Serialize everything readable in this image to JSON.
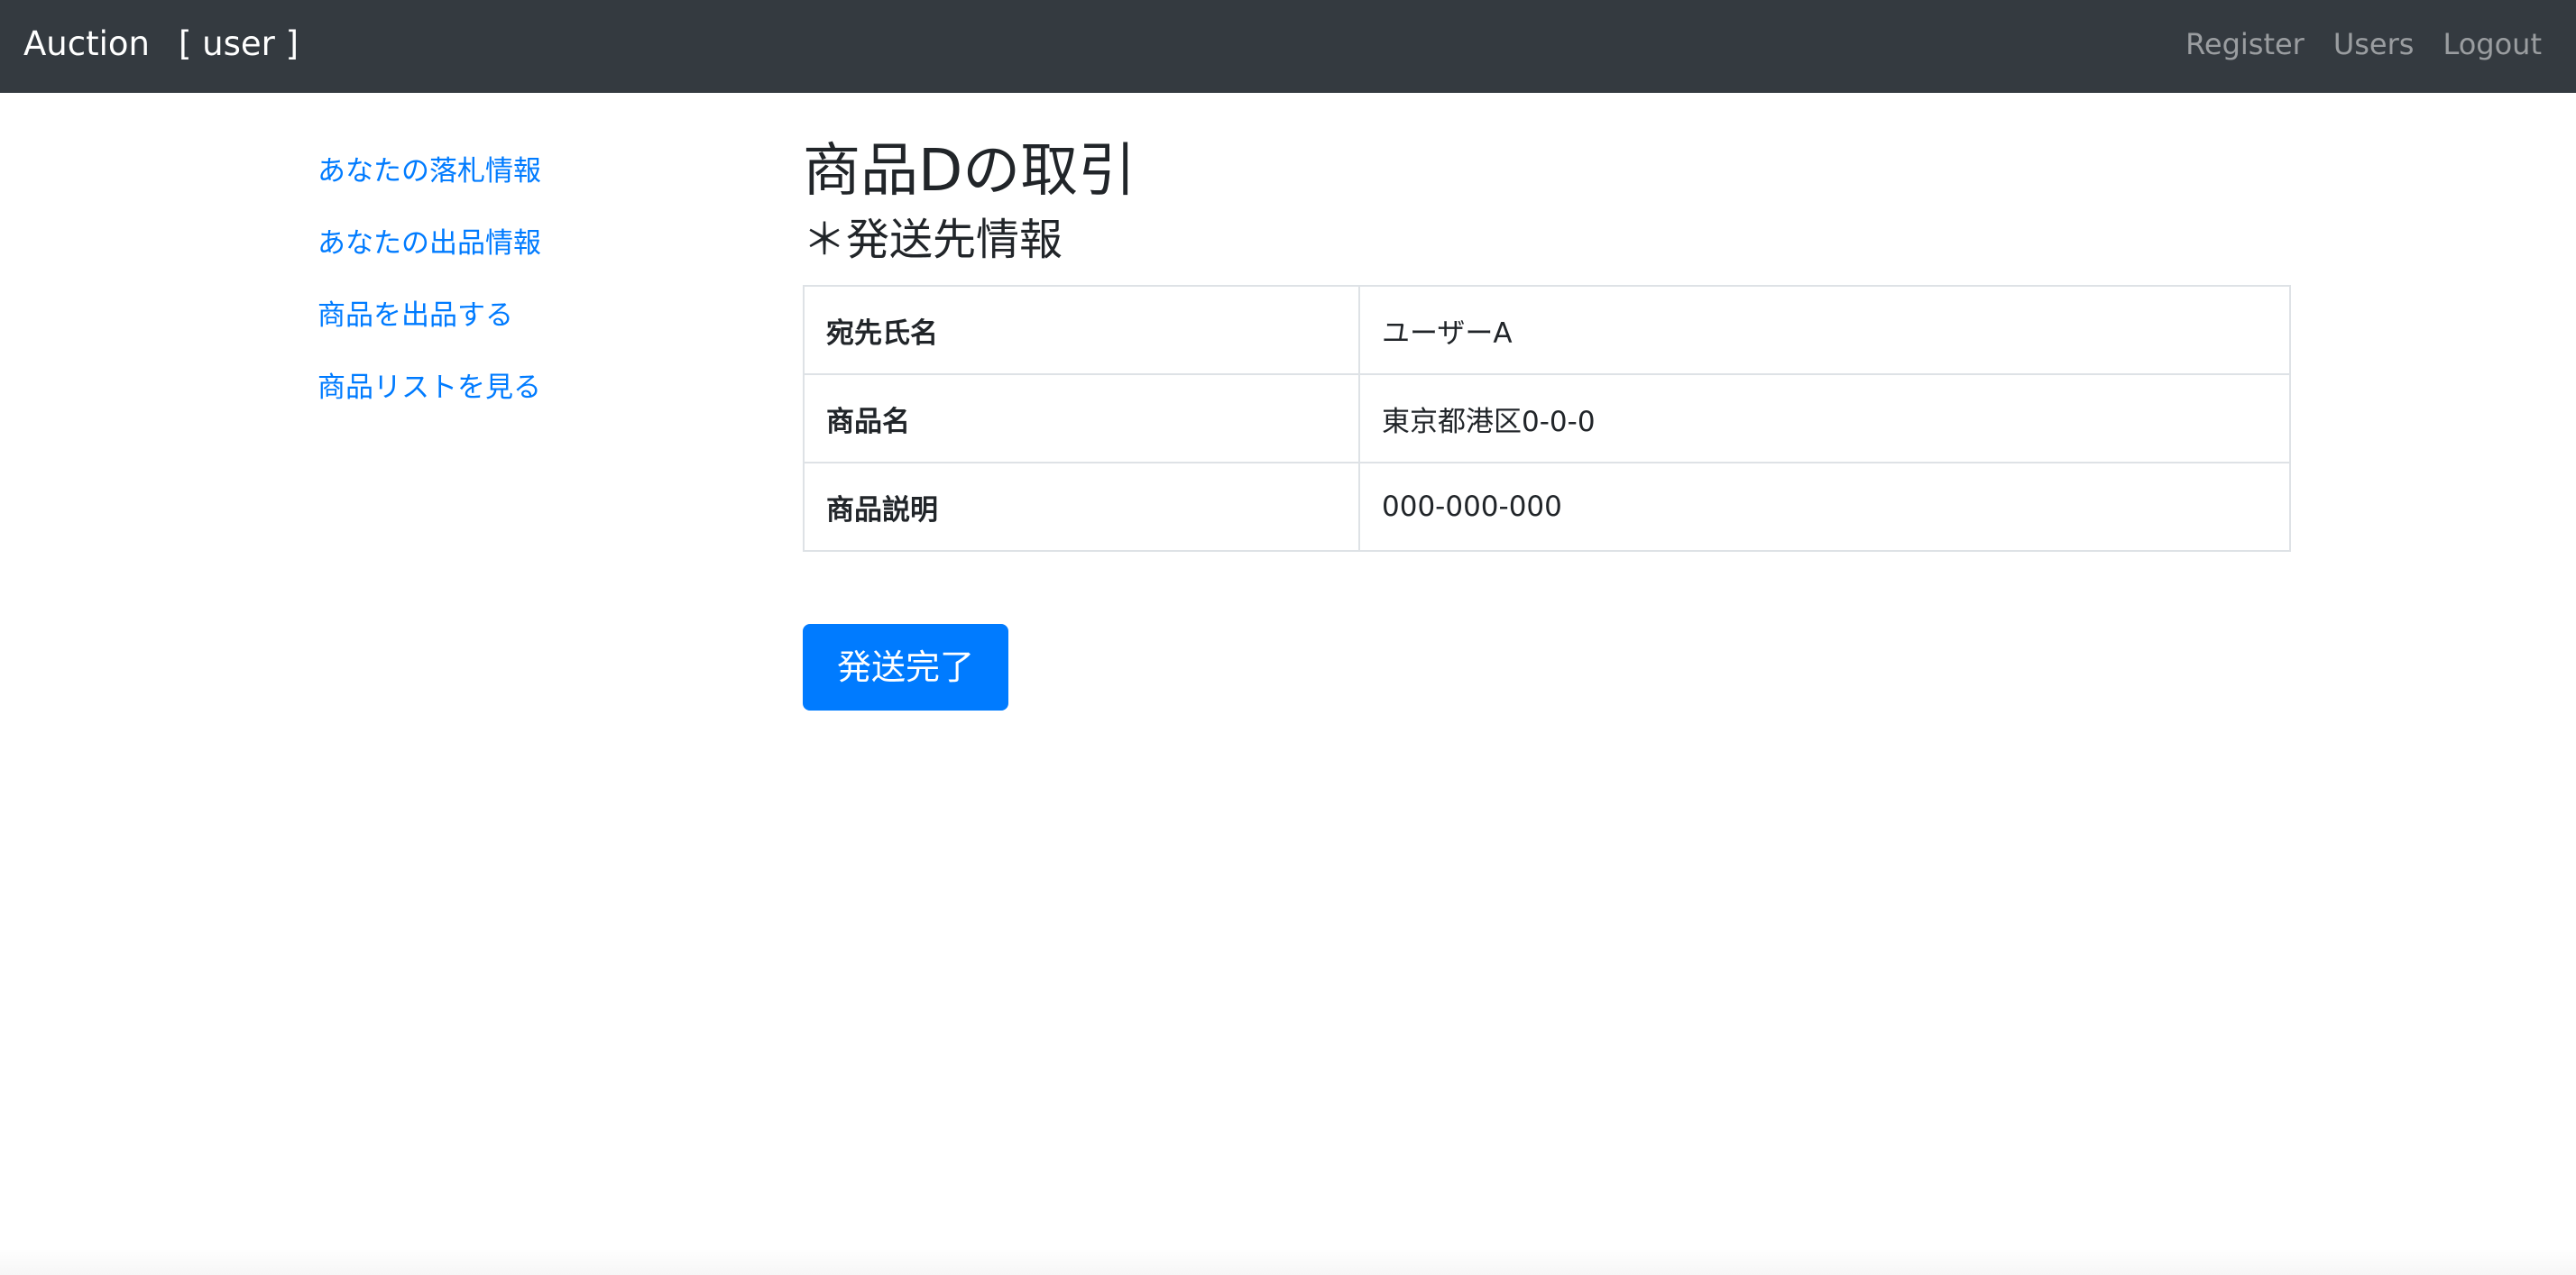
{
  "navbar": {
    "brand": "Auction",
    "user_label": "[ user ]",
    "links": [
      "Register",
      "Users",
      "Logout"
    ],
    "bg_color": "#343a40"
  },
  "sidebar": {
    "items": [
      {
        "label": "あなたの落札情報"
      },
      {
        "label": "あなたの出品情報"
      },
      {
        "label": "商品を出品する"
      },
      {
        "label": "商品リストを見る"
      }
    ],
    "link_color": "#007bff"
  },
  "main": {
    "title": "商品Dの取引",
    "subtitle": "＊発送先情報",
    "table": {
      "rows": [
        {
          "key": "宛先氏名",
          "value": "ユーザーA"
        },
        {
          "key": "商品名",
          "value": "東京都港区0-0-0"
        },
        {
          "key": "商品説明",
          "value": "000-000-000"
        }
      ]
    },
    "button_label": "発送完了",
    "button_color": "#007bff"
  }
}
